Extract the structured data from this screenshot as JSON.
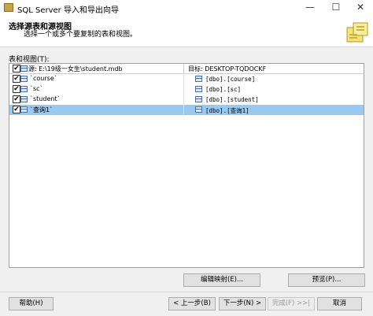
{
  "window": {
    "title": "SQL Server 导入和导出向导",
    "min": "—",
    "max": "☐",
    "close": "✕"
  },
  "header": {
    "title": "选择源表和源视图",
    "subtitle": "选择一个或多个要复制的表和视图。"
  },
  "list": {
    "label": "表和视图(T):",
    "columns": {
      "source": "源: E:\\19级一女生\\student.mdb",
      "destination": "目标: DESKTOP-TQDOCKF"
    },
    "rows": [
      {
        "checked": "✔",
        "source": "`course`",
        "destination": "[dbo].[course]"
      },
      {
        "checked": "✔",
        "source": "`sc`",
        "destination": "[dbo].[sc]"
      },
      {
        "checked": "✔",
        "source": "`student`",
        "destination": "[dbo].[student]"
      },
      {
        "checked": "✔",
        "source": "`查询1`",
        "destination": "[dbo].[查询1]"
      }
    ],
    "header_checked": "✔"
  },
  "buttons": {
    "edit_mappings": "编辑映射(E)...",
    "preview": "预览(P)...",
    "help": "帮助(H)",
    "back": "< 上一步(B)",
    "next": "下一步(N) >",
    "finish": "完成(F) >>|",
    "cancel": "取消"
  }
}
